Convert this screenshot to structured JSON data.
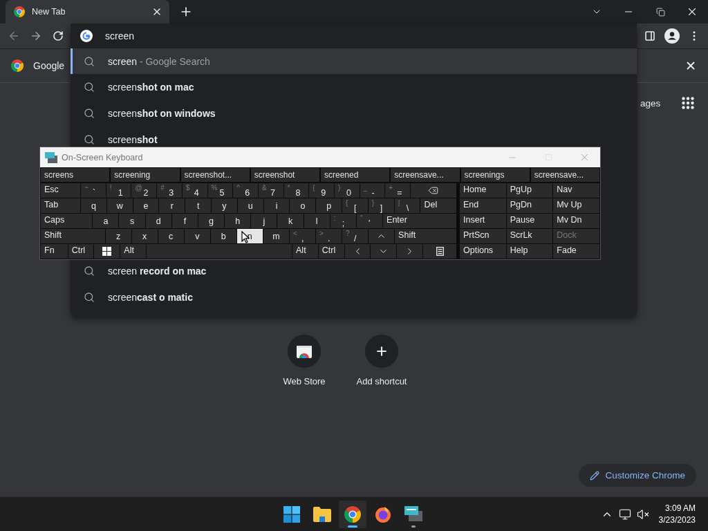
{
  "tab": {
    "title": "New Tab"
  },
  "omnibox": {
    "value": "screen"
  },
  "info_bar": {
    "text": "Google"
  },
  "dropdown": {
    "suggestions": [
      {
        "text": "screen",
        "hint": " - Google Search",
        "selected": true
      },
      {
        "text": "screen**shot on mac**",
        "selected": false
      },
      {
        "text": "screen**shot on windows**",
        "selected": false
      },
      {
        "text": "screen**shot**",
        "selected": false
      }
    ],
    "more_suggestions": [
      {
        "text": "screen **record on mac**",
        "selected": false
      },
      {
        "text": "screen**cast o matic**",
        "selected": false
      }
    ]
  },
  "page": {
    "header_link": "ages",
    "shortcuts": [
      {
        "kind": "webstore",
        "label": "Web Store"
      },
      {
        "kind": "add",
        "label": "Add shortcut"
      }
    ],
    "customize_button": "Customize Chrome"
  },
  "osk": {
    "title": "On-Screen Keyboard",
    "predictions": [
      "screens",
      "screening",
      "screenshot...",
      "screenshot",
      "screened",
      "screensave...",
      "screenings",
      "screensave..."
    ],
    "main_rows": [
      [
        {
          "label": "Esc",
          "hovered": false
        },
        {
          "shift": "~",
          "label": "`",
          "hovered": false
        },
        {
          "shift": "!",
          "label": "1",
          "hovered": false
        },
        {
          "shift": "@",
          "label": "2",
          "hovered": false
        },
        {
          "shift": "#",
          "label": "3",
          "hovered": false
        },
        {
          "shift": "$",
          "label": "4",
          "hovered": false
        },
        {
          "shift": "%",
          "label": "5",
          "hovered": false
        },
        {
          "shift": "^",
          "label": "6",
          "hovered": false
        },
        {
          "shift": "&",
          "label": "7",
          "hovered": false
        },
        {
          "shift": "*",
          "label": "8",
          "hovered": false
        },
        {
          "shift": "(",
          "label": "9",
          "hovered": false
        },
        {
          "shift": ")",
          "label": "0",
          "hovered": false
        },
        {
          "shift": "_",
          "label": "-",
          "hovered": false
        },
        {
          "shift": "+",
          "label": "=",
          "hovered": false
        },
        {
          "kind": "backspace",
          "hovered": false
        }
      ],
      [
        {
          "label": "Tab",
          "hovered": false
        },
        {
          "label": "q",
          "hovered": false
        },
        {
          "label": "w",
          "hovered": false
        },
        {
          "label": "e",
          "hovered": false
        },
        {
          "label": "r",
          "hovered": false
        },
        {
          "label": "t",
          "hovered": false
        },
        {
          "label": "y",
          "hovered": false
        },
        {
          "label": "u",
          "hovered": false
        },
        {
          "label": "i",
          "hovered": false
        },
        {
          "label": "o",
          "hovered": false
        },
        {
          "label": "p",
          "hovered": false
        },
        {
          "shift": "{",
          "label": "[",
          "hovered": false
        },
        {
          "shift": "}",
          "label": "]",
          "hovered": false
        },
        {
          "shift": "|",
          "label": "\\",
          "hovered": false
        },
        {
          "label": "Del",
          "hovered": false
        }
      ],
      [
        {
          "label": "Caps",
          "hovered": false
        },
        {
          "label": "a",
          "hovered": false
        },
        {
          "label": "s",
          "hovered": false
        },
        {
          "label": "d",
          "hovered": false
        },
        {
          "label": "f",
          "hovered": false
        },
        {
          "label": "g",
          "hovered": false
        },
        {
          "label": "h",
          "hovered": false
        },
        {
          "label": "j",
          "hovered": false
        },
        {
          "label": "k",
          "hovered": false
        },
        {
          "label": "l",
          "hovered": false
        },
        {
          "shift": ":",
          "label": ";",
          "hovered": false
        },
        {
          "shift": "\"",
          "label": "'",
          "hovered": false
        },
        {
          "label": "Enter",
          "hovered": false
        }
      ],
      [
        {
          "label": "Shift",
          "hovered": false
        },
        {
          "label": "z",
          "hovered": false
        },
        {
          "label": "x",
          "hovered": false
        },
        {
          "label": "c",
          "hovered": false
        },
        {
          "label": "v",
          "hovered": false
        },
        {
          "label": "b",
          "hovered": false
        },
        {
          "label": "n",
          "hovered": true
        },
        {
          "label": "m",
          "hovered": false
        },
        {
          "shift": "<",
          "label": ",",
          "hovered": false
        },
        {
          "shift": ">",
          "label": ".",
          "hovered": false
        },
        {
          "shift": "?",
          "label": "/",
          "hovered": false
        },
        {
          "kind": "up",
          "hovered": false
        },
        {
          "label": "Shift",
          "hovered": false
        }
      ],
      [
        {
          "label": "Fn",
          "hovered": false
        },
        {
          "label": "Ctrl",
          "hovered": false
        },
        {
          "kind": "windows",
          "hovered": false
        },
        {
          "label": "Alt",
          "hovered": false
        },
        {
          "kind": "space",
          "hovered": false
        },
        {
          "label": "Alt",
          "hovered": false
        },
        {
          "label": "Ctrl",
          "hovered": false
        },
        {
          "kind": "left",
          "hovered": false
        },
        {
          "kind": "down",
          "hovered": false
        },
        {
          "kind": "right",
          "hovered": false
        },
        {
          "kind": "menu",
          "hovered": false
        }
      ]
    ],
    "side_rows": [
      [
        {
          "label": "Home",
          "disabled": false
        },
        {
          "label": "PgUp",
          "disabled": false
        },
        {
          "label": "Nav",
          "disabled": false
        }
      ],
      [
        {
          "label": "End",
          "disabled": false
        },
        {
          "label": "PgDn",
          "disabled": false
        },
        {
          "label": "Mv Up",
          "disabled": false
        }
      ],
      [
        {
          "label": "Insert",
          "disabled": false
        },
        {
          "label": "Pause",
          "disabled": false
        },
        {
          "label": "Mv Dn",
          "disabled": false
        }
      ],
      [
        {
          "label": "PrtScn",
          "disabled": false
        },
        {
          "label": "ScrLk",
          "disabled": false
        },
        {
          "label": "Dock",
          "disabled": true
        }
      ],
      [
        {
          "label": "Options",
          "disabled": false
        },
        {
          "label": "Help",
          "disabled": false
        },
        {
          "label": "Fade",
          "disabled": false
        }
      ]
    ]
  },
  "taskbar": {
    "apps": [
      {
        "kind": "start",
        "active": false
      },
      {
        "kind": "files",
        "active": false
      },
      {
        "kind": "chrome",
        "active": true
      },
      {
        "kind": "firefox",
        "active": false
      },
      {
        "kind": "keyboard",
        "active": false
      }
    ],
    "time": "3:09 AM",
    "date": "3/23/2023"
  }
}
